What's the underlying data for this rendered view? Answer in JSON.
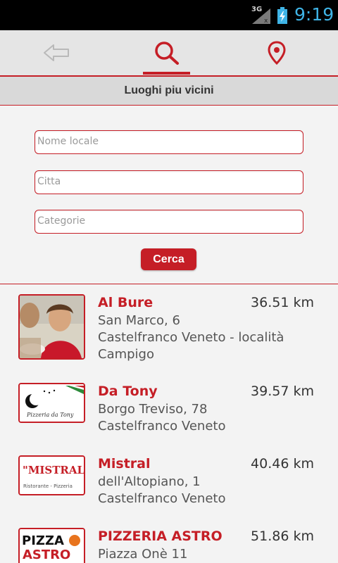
{
  "status_bar": {
    "network": "3G",
    "time": "9:19",
    "accent": "#3fb4e6"
  },
  "toolbar": {
    "back_icon": "back-arrow-icon",
    "search_icon": "search-icon",
    "location_icon": "location-pin-icon",
    "accent": "#c51e26"
  },
  "header": {
    "title": "Luoghi piu vicini"
  },
  "form": {
    "name_placeholder": "Nome locale",
    "city_placeholder": "Citta",
    "category_placeholder": "Categorie",
    "search_label": "Cerca"
  },
  "results": [
    {
      "name": "Al Bure",
      "distance": "36.51 km",
      "address_line1": "San Marco, 6",
      "address_line2": "Castelfranco Veneto - località",
      "address_line3": "Campigo",
      "thumb": "photo-woman-eating"
    },
    {
      "name": "Da Tony",
      "distance": "39.57 km",
      "address_line1": "Borgo Treviso, 78",
      "address_line2": "Castelfranco Veneto",
      "thumb_text": "Pizzeria da Tony"
    },
    {
      "name": "Mistral",
      "distance": "40.46 km",
      "address_line1": "dell'Altopiano, 1",
      "address_line2": "Castelfranco Veneto",
      "thumb_text": "\"MISTRAL\"",
      "thumb_sub": "Ristorante - Pizzeria"
    },
    {
      "name": "PIZZERIA ASTRO",
      "distance": "51.86 km",
      "address_line1": "Piazza Onè 11",
      "thumb_text": "PIZZA",
      "thumb_sub": "ASTRO"
    }
  ]
}
